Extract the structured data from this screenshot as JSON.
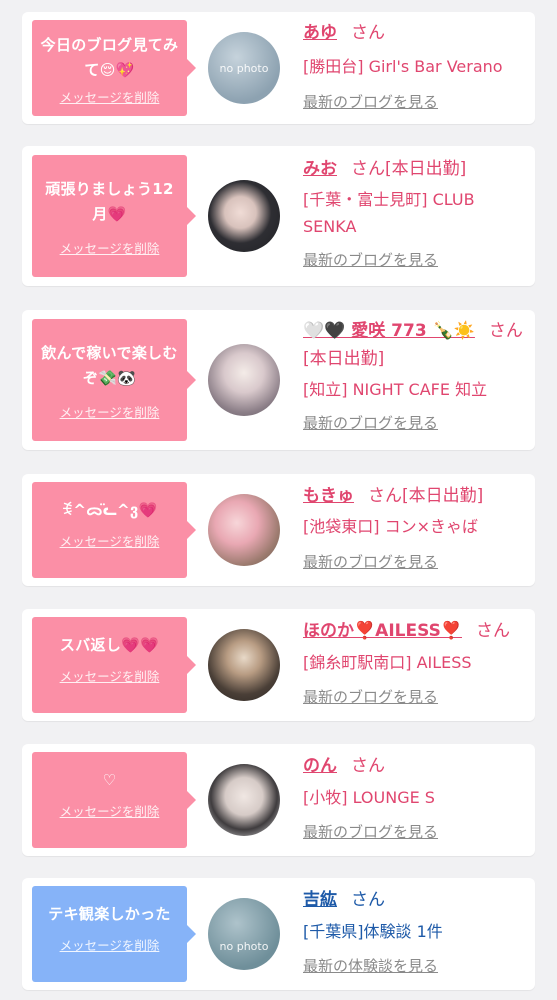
{
  "entries": [
    {
      "message": "今日のブログ見てみて😌💖",
      "delete_label": "メッセージを削除",
      "name": "あゆ",
      "san": "さん",
      "status": "",
      "shop": "[勝田台] Girl's Bar Verano",
      "link": "最新のブログを見る",
      "avatar_text": "no photo",
      "avatar_color": "#9fb2c0"
    },
    {
      "message": "頑張りましょう12月💗",
      "delete_label": "メッセージを削除",
      "name": "みお",
      "san": "さん",
      "status": "[本日出勤]",
      "shop": "[千葉・富士見町] CLUB SENKA",
      "link": "最新のブログを見る",
      "avatar_color": "#3a3a40"
    },
    {
      "message": "飲んで稼いで楽しむぞ💸🐼",
      "delete_label": "メッセージを削除",
      "name": "🤍🖤 愛咲 773 🍾☀️",
      "san": "さん",
      "status": "[本日出勤]",
      "shop": "[知立] NIGHT CAFE 知立",
      "link": "最新のブログを見る",
      "avatar_color": "#c9b7c0"
    },
    {
      "message": "ꉂ^ᯅ̈ᓚ^ვ💗",
      "delete_label": "メッセージを削除",
      "name": "もきゅ",
      "san": "さん",
      "status": "[本日出勤]",
      "shop": "[池袋東口] コン×きゃば",
      "link": "最新のブログを見る",
      "avatar_color": "#e8a9b6"
    },
    {
      "message": "スバ返し💗💗",
      "delete_label": "メッセージを削除",
      "name": "ほのか❣️AILESS❣️",
      "san": "さん",
      "status": "",
      "shop": "[錦糸町駅南口] AILESS",
      "link": "最新のブログを見る",
      "avatar_color": "#6b5a4a"
    },
    {
      "message": "♡",
      "delete_label": "メッセージを削除",
      "name": "のん",
      "san": "さん",
      "status": "",
      "shop": "[小牧] LOUNGE S",
      "link": "最新のブログを見る",
      "avatar_color": "#cfcfd2"
    },
    {
      "message": "テキ観楽しかった",
      "delete_label": "メッセージを削除",
      "name": "吉紘",
      "san": "さん",
      "status": "",
      "shop": "[千葉県]体験談 1件",
      "link": "最新の体験談を見る",
      "avatar_text": "no photo",
      "avatar_color": "#7fa2ad"
    }
  ]
}
